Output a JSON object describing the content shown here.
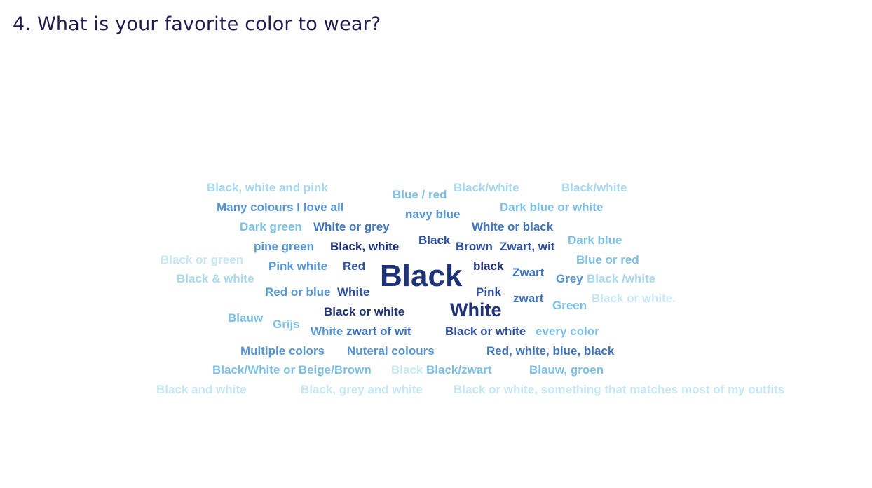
{
  "question": {
    "title": "4. What is your favorite color to wear?"
  },
  "colors": {
    "darkest": "#1f3478",
    "dark": "#2e509e",
    "medium_dark": "#3f74bf",
    "medium": "#5596d2",
    "light": "#7dc0e4",
    "lighter": "#a7d8ee",
    "lightest": "#c6e8f5",
    "title": "#1f1d4e"
  },
  "word_cloud": {
    "words": [
      {
        "text": "Black, white and pink",
        "color": "#a7d8ee"
      },
      {
        "text": "Blue / red",
        "color": "#7dc0e4"
      },
      {
        "text": "Black/white",
        "color": "#a7d8ee"
      },
      {
        "text": "Black/white",
        "color": "#a7d8ee"
      },
      {
        "text": "Many colours I love all",
        "color": "#5596d2"
      },
      {
        "text": "navy blue",
        "color": "#5596d2"
      },
      {
        "text": "Dark blue or white",
        "color": "#7dc0e4"
      },
      {
        "text": "Dark green",
        "color": "#7dc0e4"
      },
      {
        "text": "White or grey",
        "color": "#3f74bf"
      },
      {
        "text": "White or black",
        "color": "#3f74bf"
      },
      {
        "text": "Black",
        "color": "#2e509e"
      },
      {
        "text": "pine green",
        "color": "#5596d2"
      },
      {
        "text": "Black, white",
        "color": "#1f3478"
      },
      {
        "text": "Brown",
        "color": "#2e509e"
      },
      {
        "text": "Zwart, wit",
        "color": "#2e509e"
      },
      {
        "text": "Dark blue",
        "color": "#7dc0e4"
      },
      {
        "text": "Black or green",
        "color": "#c6e8f5"
      },
      {
        "text": "Pink white",
        "color": "#5596d2"
      },
      {
        "text": "Red",
        "color": "#2e509e"
      },
      {
        "text": "Black",
        "color": "#1f3478"
      },
      {
        "text": "black",
        "color": "#1f3478"
      },
      {
        "text": "Blue or red",
        "color": "#7dc0e4"
      },
      {
        "text": "Zwart",
        "color": "#3f74bf"
      },
      {
        "text": "Black & white",
        "color": "#a7d8ee"
      },
      {
        "text": "Grey",
        "color": "#5596d2"
      },
      {
        "text": "Black /white",
        "color": "#a7d8ee"
      },
      {
        "text": "Red or blue",
        "color": "#5596d2"
      },
      {
        "text": "White",
        "color": "#2e509e"
      },
      {
        "text": "Pink",
        "color": "#2e509e"
      },
      {
        "text": "zwart",
        "color": "#3f74bf"
      },
      {
        "text": "Black or white.",
        "color": "#c6e8f5"
      },
      {
        "text": "Green",
        "color": "#7dc0e4"
      },
      {
        "text": "White",
        "color": "#1f3478"
      },
      {
        "text": "Black or white",
        "color": "#1f3478"
      },
      {
        "text": "Blauw",
        "color": "#7dc0e4"
      },
      {
        "text": "Grijs",
        "color": "#7dc0e4"
      },
      {
        "text": "White",
        "color": "#5596d2"
      },
      {
        "text": "zwart of wit",
        "color": "#3f74bf"
      },
      {
        "text": "Black or white",
        "color": "#2e509e"
      },
      {
        "text": "every color",
        "color": "#7dc0e4"
      },
      {
        "text": "Multiple colors",
        "color": "#5596d2"
      },
      {
        "text": "Nuteral colours",
        "color": "#5596d2"
      },
      {
        "text": "Red, white, blue, black",
        "color": "#3f74bf"
      },
      {
        "text": "Black/White or Beige/Brown",
        "color": "#7dc0e4"
      },
      {
        "text": "Black",
        "color": "#c6e8f5"
      },
      {
        "text": "Black/zwart",
        "color": "#7dc0e4"
      },
      {
        "text": "Blauw, groen",
        "color": "#7dc0e4"
      },
      {
        "text": "Black and white",
        "color": "#c6e8f5"
      },
      {
        "text": "Black, grey and white",
        "color": "#c6e8f5"
      },
      {
        "text": "Black or white, something that matches most of my outfits",
        "color": "#c6e8f5"
      }
    ]
  }
}
